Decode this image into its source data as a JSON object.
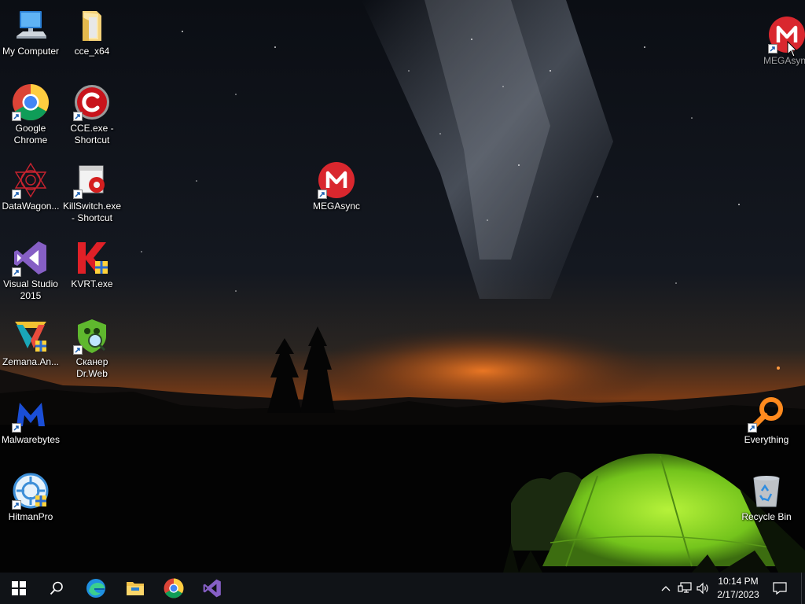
{
  "desktop": {
    "icons": [
      {
        "label": "My Computer",
        "icon": "computer-icon"
      },
      {
        "label": "cce_x64",
        "icon": "folder-icon"
      },
      {
        "label": "Google\nChrome",
        "icon": "chrome-icon"
      },
      {
        "label": "CCE.exe -\nShortcut",
        "icon": "cce-icon"
      },
      {
        "label": "DataWagon...",
        "icon": "datawagon-icon"
      },
      {
        "label": "KillSwitch.exe\n- Shortcut",
        "icon": "killswitch-icon"
      },
      {
        "label": "Visual Studio\n2015",
        "icon": "visual-studio-icon"
      },
      {
        "label": "KVRT.exe",
        "icon": "kvrt-icon"
      },
      {
        "label": "Zemana.An...",
        "icon": "zemana-icon"
      },
      {
        "label": "Сканер\nDr.Web",
        "icon": "drweb-icon"
      },
      {
        "label": "Malwarebytes",
        "icon": "malwarebytes-icon"
      },
      {
        "label": "HitmanPro",
        "icon": "hitmanpro-icon"
      },
      {
        "label": "MEGAsync",
        "icon": "mega-icon"
      },
      {
        "label": "MEGAsync",
        "icon": "mega-icon"
      },
      {
        "label": "Everything",
        "icon": "everything-icon"
      },
      {
        "label": "Recycle Bin",
        "icon": "recycle-bin-icon"
      }
    ]
  },
  "taskbar": {
    "pinned": [
      "start-icon",
      "search-icon",
      "edge-icon",
      "file-explorer-icon",
      "chrome-icon",
      "visual-studio-icon"
    ],
    "tray": [
      "chevron-up-icon",
      "network-icon",
      "volume-icon"
    ],
    "time": "10:14 PM",
    "date": "2/17/2023",
    "notification_icon": "action-center-icon"
  },
  "colors": {
    "taskbar": "#101317",
    "mega_red": "#d9272e",
    "tent_green": "#8fe02a",
    "horizon_orange": "#e2661c",
    "visual_studio_purple": "#865fc5"
  }
}
